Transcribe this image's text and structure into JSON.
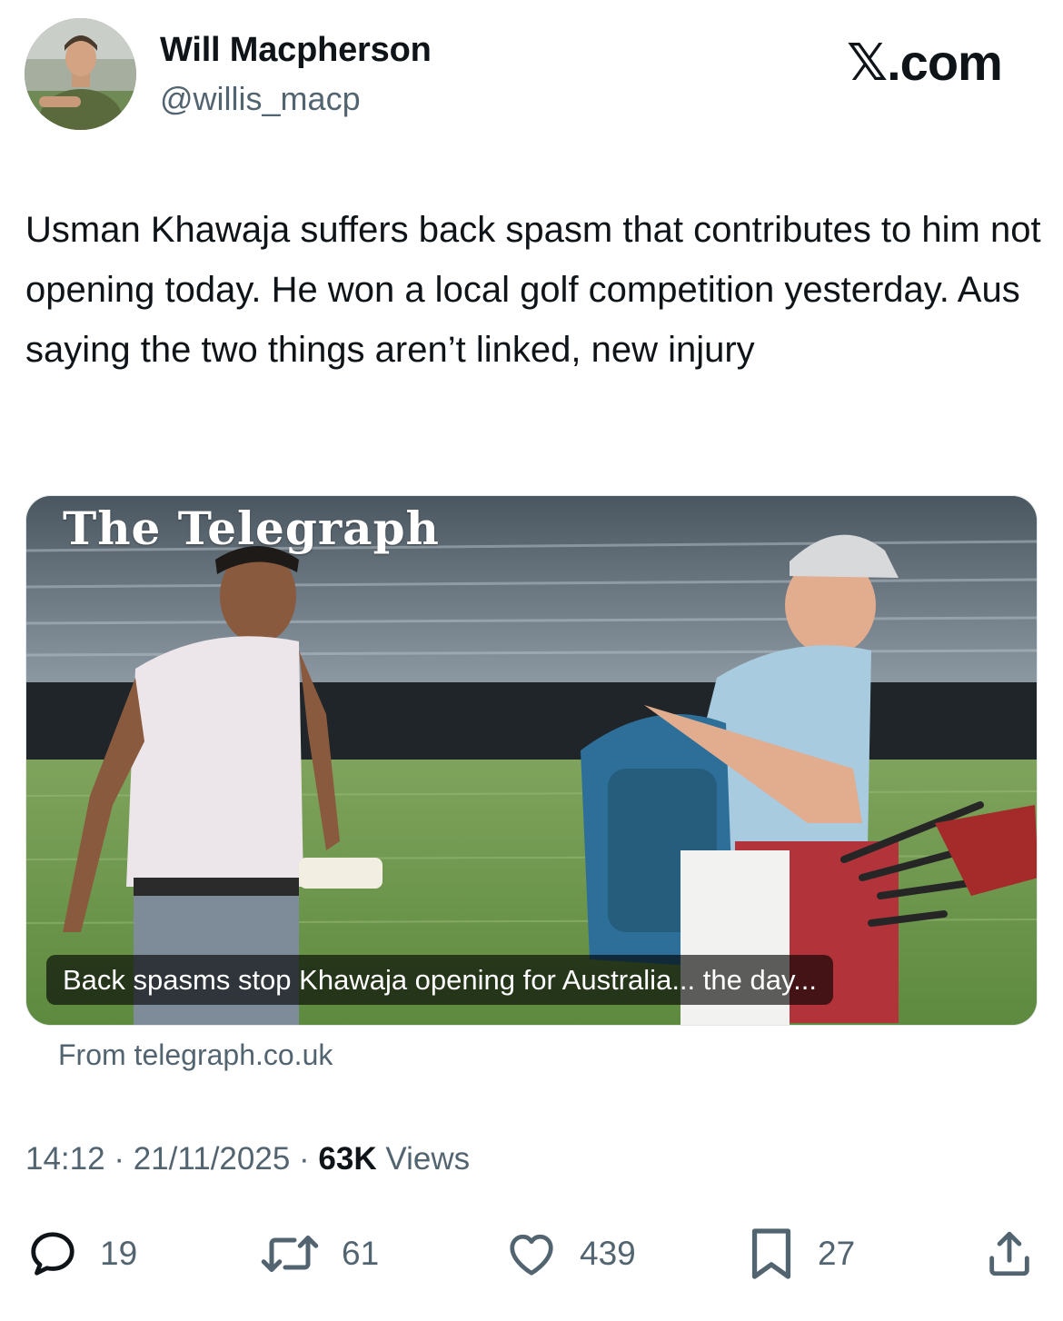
{
  "author": {
    "display_name": "Will Macpherson",
    "handle": "@willis_macp"
  },
  "source_logo": "𝕏.com",
  "tweet_text": "Usman Khawaja suffers back spasm that contributes to him not opening today. He won a local golf competition yesterday. Aus saying the two things aren’t linked, new injury",
  "card": {
    "masthead": "The Telegraph",
    "headline": "Back spasms stop Khawaja opening for Australia... the day...",
    "source": "From telegraph.co.uk"
  },
  "meta": {
    "time": "14:12",
    "separator": "·",
    "date": "21/11/2025",
    "views_count": "63K",
    "views_label": "Views"
  },
  "actions": {
    "replies": "19",
    "reposts": "61",
    "likes": "439",
    "bookmarks": "27"
  },
  "icons": {
    "reply": "reply-icon",
    "repost": "repost-icon",
    "like": "heart-icon",
    "bookmark": "bookmark-icon",
    "share": "share-icon"
  },
  "colors": {
    "text_primary": "#0f1419",
    "text_secondary": "#536471",
    "card_border": "#e1e6ea"
  }
}
